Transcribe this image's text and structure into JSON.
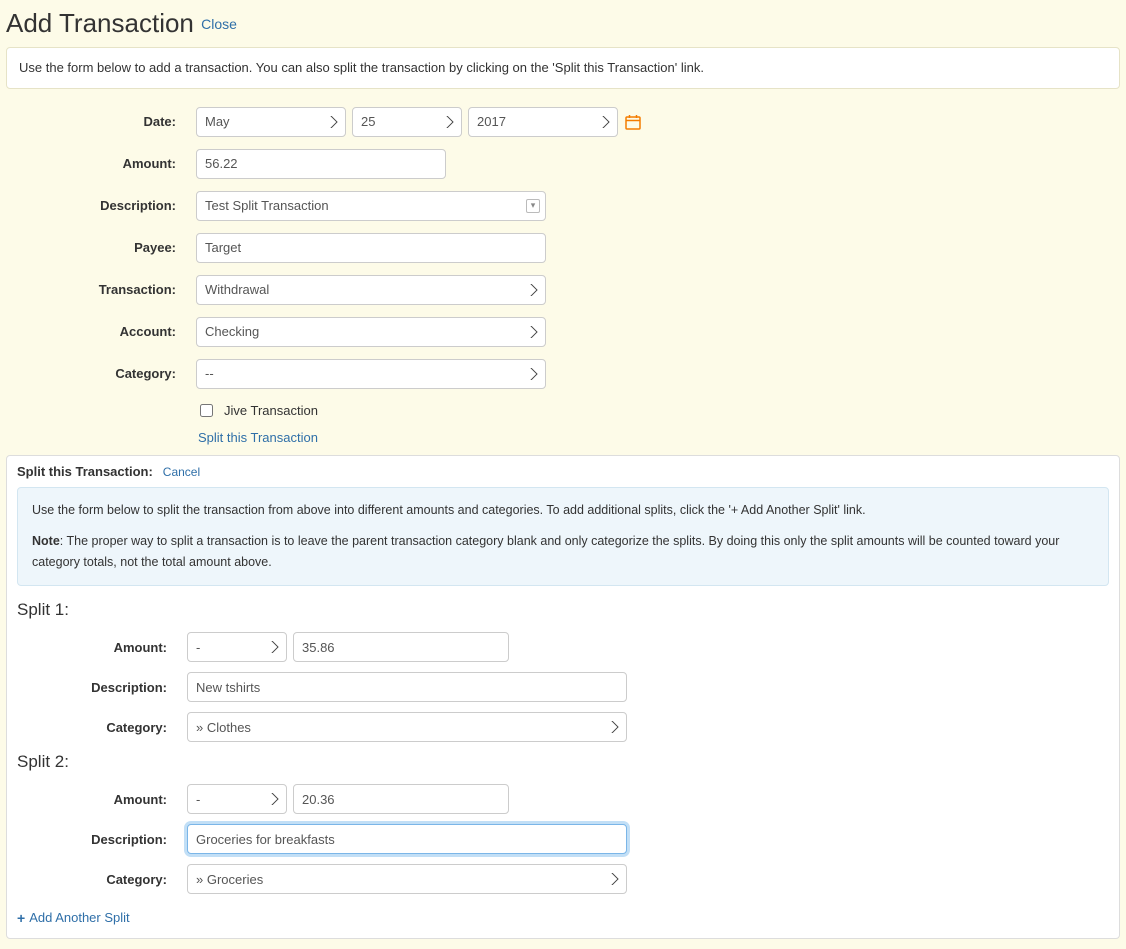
{
  "header": {
    "title": "Add Transaction",
    "close": "Close"
  },
  "info": "Use the form below to add a transaction. You can also split the transaction by clicking on the 'Split this Transaction' link.",
  "labels": {
    "date": "Date:",
    "amount": "Amount:",
    "description": "Description:",
    "payee": "Payee:",
    "transaction": "Transaction:",
    "account": "Account:",
    "category": "Category:"
  },
  "form": {
    "month": "May",
    "day": "25",
    "year": "2017",
    "amount": "56.22",
    "description": "Test Split Transaction",
    "payee": "Target",
    "transaction": "Withdrawal",
    "account": "Checking",
    "category": "--",
    "jiveLabel": "Jive Transaction",
    "splitLink": "Split this Transaction"
  },
  "split": {
    "header": "Split this Transaction:",
    "cancel": "Cancel",
    "noteLine1": "Use the form below to split the transaction from above into different amounts and categories. To add additional splits, click the '+ Add Another Split' link.",
    "noteBold": "Note",
    "noteLine2": ": The proper way to split a transaction is to leave the parent transaction category blank and only categorize the splits. By doing this only the split amounts will be counted toward your category totals, not the total amount above.",
    "addAnother": "Add Another Split",
    "splits": [
      {
        "title": "Split 1:",
        "sign": "-",
        "amount": "35.86",
        "description": "New tshirts",
        "category": "» Clothes"
      },
      {
        "title": "Split 2:",
        "sign": "-",
        "amount": "20.36",
        "description": "Groceries for breakfasts",
        "category": "» Groceries"
      }
    ]
  }
}
